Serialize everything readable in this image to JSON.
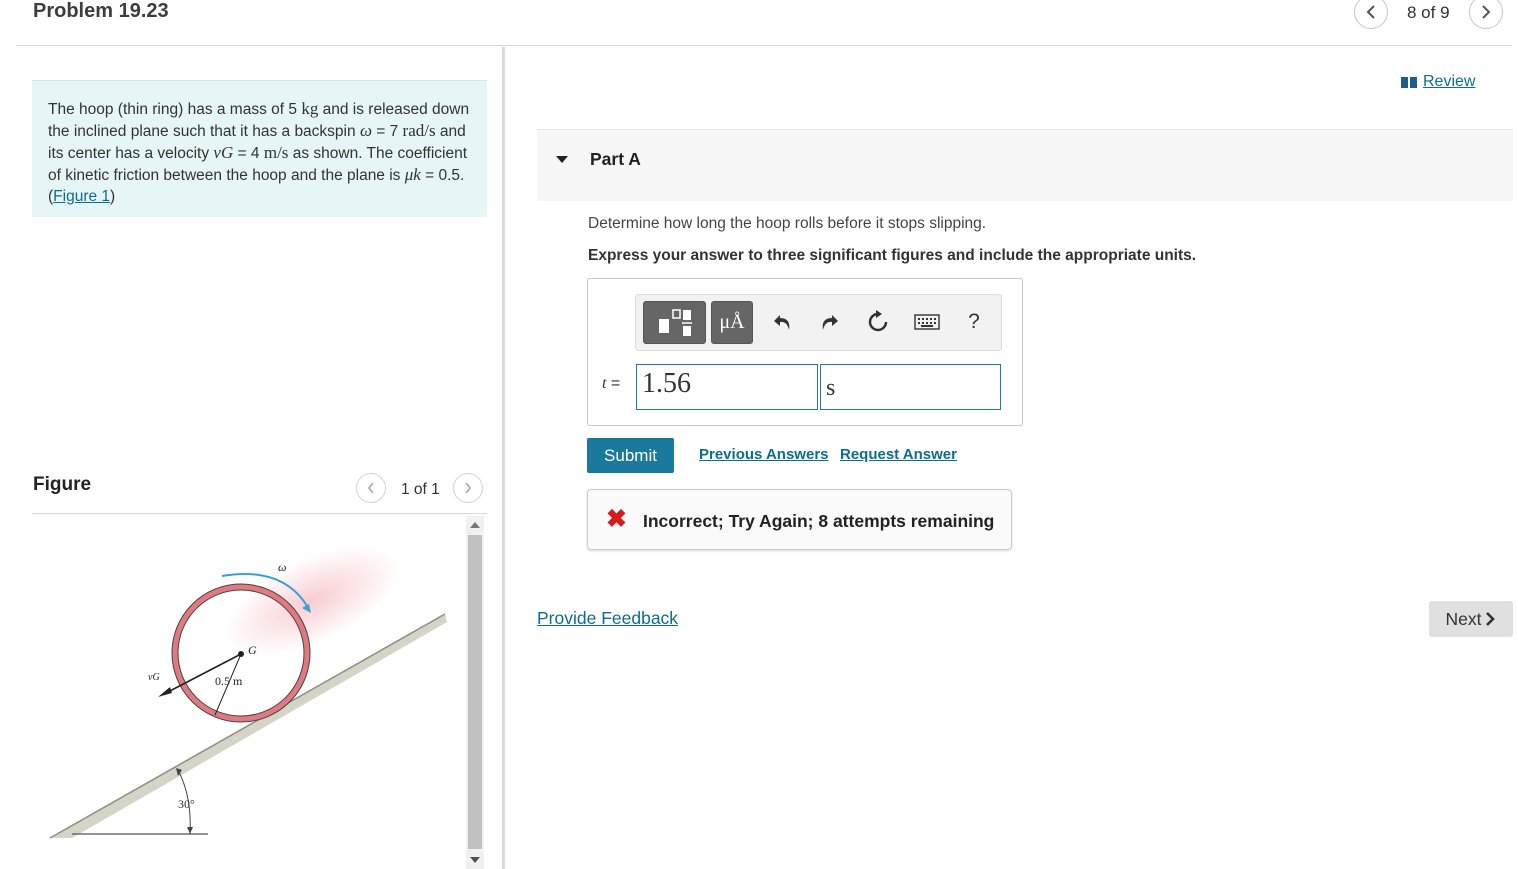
{
  "header": {
    "title": "Problem 19.23",
    "pager": "8 of 9",
    "prev_icon": "chevron-left-icon",
    "next_icon": "chevron-right-icon"
  },
  "problem": {
    "t1": "The hoop (thin ring) has a mass of 5 ",
    "kg": "kg",
    "t2": " and is released down the inclined plane such that it has a backspin ",
    "omega": "ω",
    "eq1": " = 7 ",
    "rad": "rad/s",
    "t3": " and its center has a velocity ",
    "vg": "vG",
    "eq2": " = 4 ",
    "ms": "m/s",
    "t4": " as shown. The coefficient of kinetic friction between the hoop and the plane is ",
    "mu": "μk",
    "eq3": " = 0.5. (",
    "figure_link": "Figure 1",
    "t5": ")"
  },
  "figure": {
    "label": "Figure",
    "pager": "1 of 1",
    "omega_label": "ω",
    "g_label": "G",
    "vg_label": "vG",
    "radius_label": "0.5 m",
    "angle_label": "30°"
  },
  "review": {
    "label": "Review",
    "icon": "book-icon"
  },
  "part": {
    "title": "Part A",
    "question": "Determine how long the hoop rolls before it stops slipping.",
    "instruction": "Express your answer to three significant figures and include the appropriate units."
  },
  "toolbar": {
    "units_label": "μÅ",
    "help_label": "?",
    "icons": [
      "templates-icon",
      "units-icon",
      "undo-icon",
      "redo-icon",
      "reset-icon",
      "keyboard-icon",
      "help-icon"
    ]
  },
  "answer": {
    "var_name": "t",
    "equals": " =",
    "value": "1.56",
    "unit": "s"
  },
  "actions": {
    "submit": "Submit",
    "previous_answers": "Previous Answers",
    "request_answer": "Request Answer"
  },
  "feedback": {
    "icon": "x-icon",
    "message": "Incorrect; Try Again; 8 attempts remaining"
  },
  "footer": {
    "provide_feedback": "Provide Feedback",
    "next": "Next"
  },
  "colors": {
    "accent": "#1b7a9c",
    "link": "#0b6f8c",
    "error": "#d31c1c",
    "problem_bg": "#e6f5f5",
    "hoop": "#e07a80"
  }
}
